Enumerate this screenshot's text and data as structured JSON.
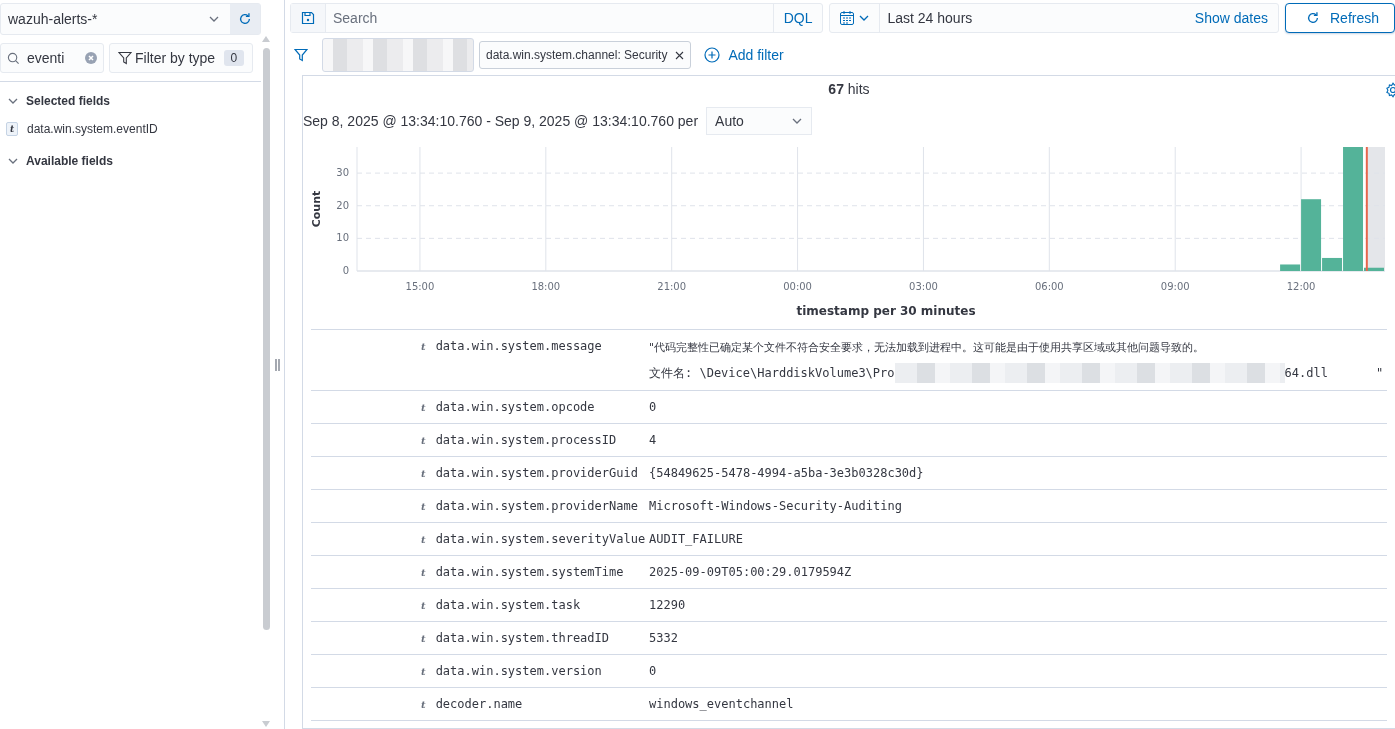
{
  "sidebar": {
    "index_pattern": "wazuh-alerts-*",
    "field_search": {
      "value": "eventi"
    },
    "filter_by_type": {
      "label": "Filter by type",
      "count": "0"
    },
    "sections": [
      {
        "title": "Selected fields",
        "expanded": true,
        "fields": [
          {
            "type": "t",
            "name": "data.win.system.eventID"
          }
        ]
      },
      {
        "title": "Available fields",
        "expanded": true
      }
    ]
  },
  "query_bar": {
    "placeholder": "Search",
    "language": "DQL",
    "time_range": "Last 24 hours",
    "show_dates": "Show dates",
    "refresh": "Refresh"
  },
  "filters": [
    {
      "kind": "redacted"
    },
    {
      "kind": "pill",
      "label": "data.win.system.channel: Security"
    }
  ],
  "add_filter": "Add filter",
  "histogram": {
    "hits_count": "67",
    "hits_label": "hits",
    "range": "Sep 8, 2025 @ 13:34:10.760 - Sep 9, 2025 @ 13:34:10.760 per",
    "interval": "Auto",
    "chart_data": {
      "type": "bar",
      "xlabel": "timestamp per 30 minutes",
      "ylabel": "Count",
      "grid": true,
      "x": [
        "2025-09-09T11:45",
        "2025-09-09T12:15",
        "2025-09-09T12:45",
        "2025-09-09T13:15",
        "2025-09-09T13:45"
      ],
      "series": [
        {
          "color": "#54b399",
          "values": [
            2,
            22,
            4,
            38,
            1
          ]
        }
      ],
      "xlim": [
        "2025-09-08T13:30",
        "2025-09-09T14:00"
      ],
      "ylim": [
        0,
        38
      ],
      "bands": [
        {
          "axis": "x",
          "from": "2025-09-09T13:34",
          "to": "2025-09-09T14:00",
          "color": "#e4e6ea"
        }
      ],
      "ref_lines": [
        {
          "axis": "x",
          "value": "2025-09-09T13:34",
          "color": "#e7664c"
        }
      ],
      "xticks": [
        {
          "value": "2025-09-08T15:00",
          "label": "15:00"
        },
        {
          "value": "2025-09-08T18:00",
          "label": "18:00"
        },
        {
          "value": "2025-09-08T21:00",
          "label": "21:00"
        },
        {
          "value": "2025-09-09T00:00",
          "label": "00:00"
        },
        {
          "value": "2025-09-09T03:00",
          "label": "03:00"
        },
        {
          "value": "2025-09-09T06:00",
          "label": "06:00"
        },
        {
          "value": "2025-09-09T09:00",
          "label": "09:00"
        },
        {
          "value": "2025-09-09T12:00",
          "label": "12:00"
        }
      ],
      "yticks": [
        0,
        10,
        20,
        30
      ]
    }
  },
  "document": {
    "rows": [
      {
        "type": "t",
        "field": "data.win.system.message",
        "kind": "multiline",
        "lines": [
          [
            {
              "kind": "text",
              "text": "\"代码完整性已确定某个文件不符合安全要求，无法加载到进程中。这可能是由于使用共享区域或其他问题导致的。"
            }
          ],
          [
            {
              "kind": "text",
              "text": "文件名:  \\Device\\HarddiskVolume3\\Pro"
            },
            {
              "kind": "redacted"
            },
            {
              "kind": "text",
              "text": "64.dll"
            },
            {
              "kind": "quote",
              "text": "\""
            }
          ]
        ]
      },
      {
        "type": "t",
        "field": "data.win.system.opcode",
        "value": "0"
      },
      {
        "type": "t",
        "field": "data.win.system.processID",
        "value": "4"
      },
      {
        "type": "t",
        "field": "data.win.system.providerGuid",
        "value": "{54849625-5478-4994-a5ba-3e3b0328c30d}"
      },
      {
        "type": "t",
        "field": "data.win.system.providerName",
        "value": "Microsoft-Windows-Security-Auditing"
      },
      {
        "type": "t",
        "field": "data.win.system.severityValue",
        "value": "AUDIT_FAILURE"
      },
      {
        "type": "t",
        "field": "data.win.system.systemTime",
        "value": "2025-09-09T05:00:29.0179594Z"
      },
      {
        "type": "t",
        "field": "data.win.system.task",
        "value": "12290"
      },
      {
        "type": "t",
        "field": "data.win.system.threadID",
        "value": "5332"
      },
      {
        "type": "t",
        "field": "data.win.system.version",
        "value": "0"
      },
      {
        "type": "t",
        "field": "decoder.name",
        "value": "windows_eventchannel"
      }
    ]
  }
}
